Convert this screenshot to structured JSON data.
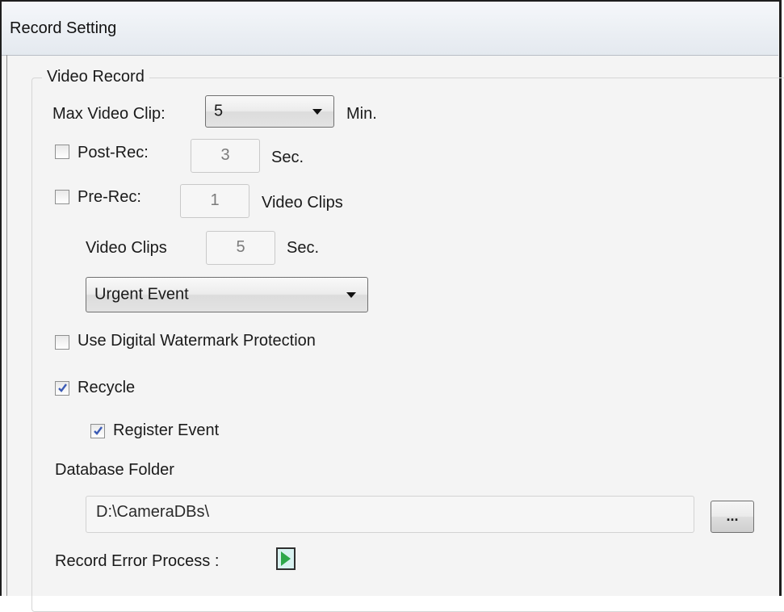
{
  "window": {
    "title": "Record Setting"
  },
  "group": {
    "title": "Video Record"
  },
  "max_clip": {
    "label": "Max Video Clip:",
    "value": "5",
    "unit": "Min."
  },
  "post_rec": {
    "label": "Post-Rec:",
    "checked": false,
    "value": "3",
    "unit": "Sec."
  },
  "pre_rec": {
    "label": "Pre-Rec:",
    "checked": false,
    "value": "1",
    "unit": "Video Clips"
  },
  "clip_length": {
    "label": "Video Clips",
    "value": "5",
    "unit": "Sec."
  },
  "event_select": {
    "value": "Urgent Event"
  },
  "watermark": {
    "label": "Use Digital Watermark Protection",
    "checked": false
  },
  "recycle": {
    "label": "Recycle",
    "checked": true
  },
  "register_event": {
    "label": "Register Event",
    "checked": true
  },
  "database": {
    "label": "Database Folder",
    "path": "D:\\CameraDBs\\",
    "browse_label": "..."
  },
  "error_process": {
    "label": "Record Error Process :"
  },
  "icons": {
    "checkmark": "checkmark-icon",
    "play": "play-icon",
    "dropdown": "chevron-down-icon"
  },
  "colors": {
    "check": "#3b5bb5",
    "play": "#2da84a"
  }
}
